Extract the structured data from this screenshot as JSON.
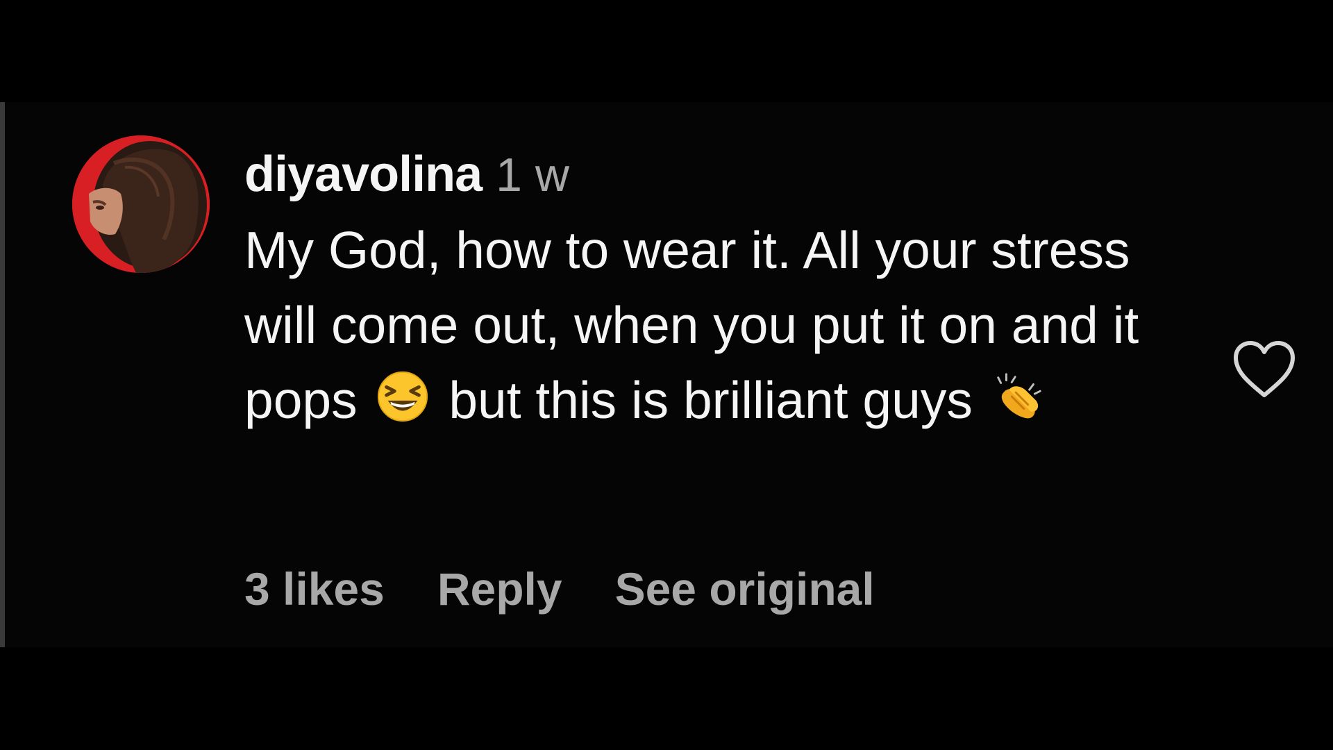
{
  "comment": {
    "username": "diyavolina",
    "timestamp": "1 w",
    "text_part1": "My God, how to wear it. All your stress will come out, when you put it on and it pops",
    "emoji_1": "laughing-squinting-face-emoji",
    "text_part2": "but this is brilliant guys",
    "emoji_2": "clapping-hands-emoji"
  },
  "actions": {
    "likes": "3 likes",
    "reply": "Reply",
    "see_original": "See original"
  },
  "colors": {
    "background": "#000000",
    "primary_text": "#f5f5f5",
    "secondary_text": "#a8a8a8",
    "avatar_ring": "#d71f24"
  }
}
